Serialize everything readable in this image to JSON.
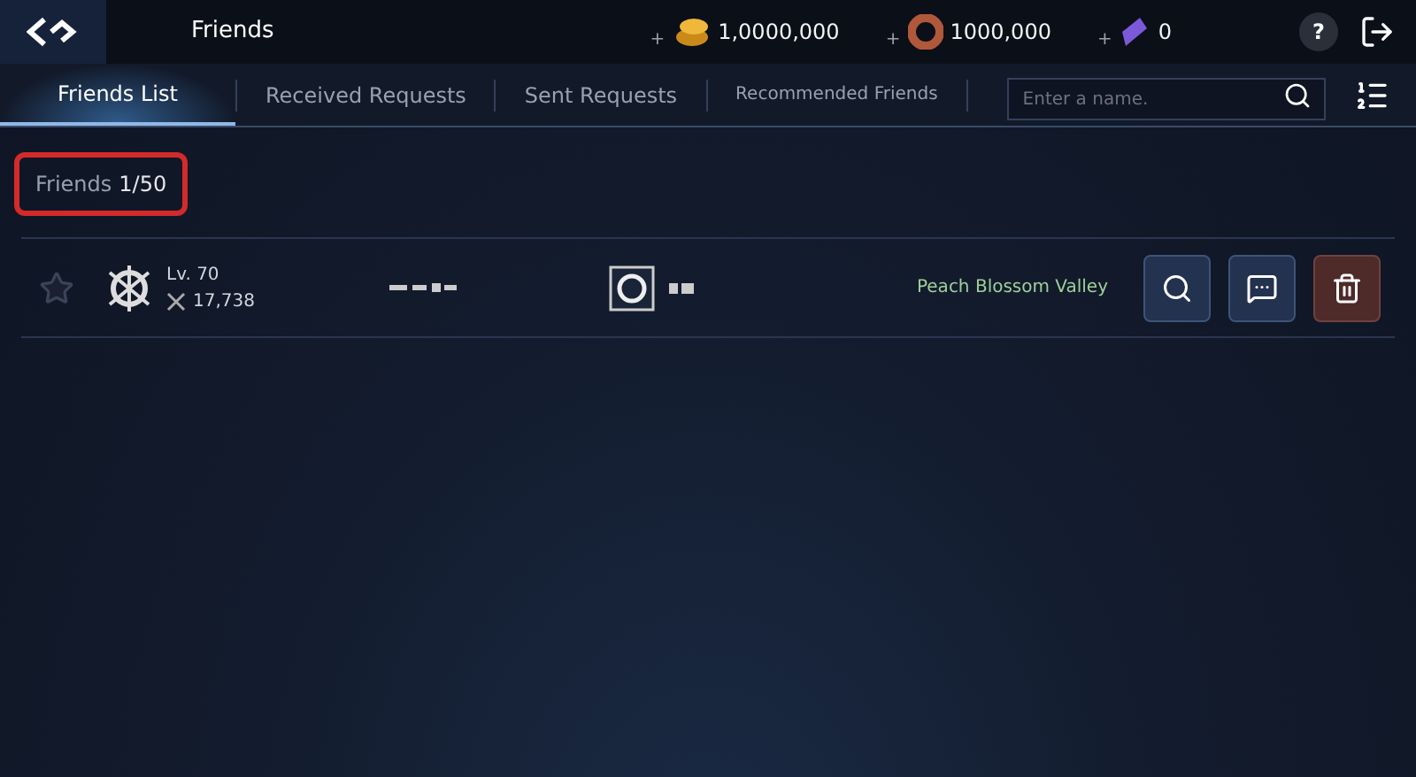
{
  "header": {
    "title": "Friends",
    "currencies": [
      {
        "kind": "gold",
        "plus": "+",
        "amount": "1,0000,000"
      },
      {
        "kind": "donut",
        "plus": "+",
        "amount": "1000,000"
      },
      {
        "kind": "crystal",
        "plus": "+",
        "amount": "0"
      }
    ],
    "help": "?"
  },
  "tabs": [
    {
      "label": "Friends List",
      "selected": true
    },
    {
      "label": "Received Requests",
      "selected": false
    },
    {
      "label": "Sent Requests",
      "selected": false
    },
    {
      "label": "Recommended Friends",
      "selected": false
    }
  ],
  "search": {
    "placeholder": "Enter a name."
  },
  "friend_count": {
    "label": "Friends",
    "value": "1/50",
    "highlighted": true
  },
  "friends": [
    {
      "favorite": false,
      "level": "Lv. 70",
      "power": "17,738",
      "location": "Peach Blossom Valley"
    }
  ]
}
